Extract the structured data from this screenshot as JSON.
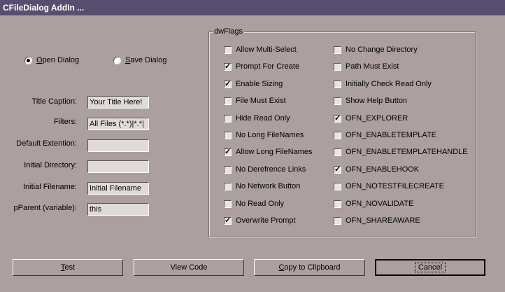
{
  "window": {
    "title": "CFileDialog AddIn ..."
  },
  "dialog_type": {
    "open_label": "Open Dialog",
    "save_label": "Save Dialog",
    "selected": "open"
  },
  "fields": [
    {
      "label": "Title Caption:",
      "value": "Your Title Here!"
    },
    {
      "label": "Filters:",
      "value": "All Files (*.*)|*.*|"
    },
    {
      "label": "Default Extention:",
      "value": ""
    },
    {
      "label": "Initial Directory:",
      "value": ""
    },
    {
      "label": "Initial Filename:",
      "value": "Initial Filename"
    },
    {
      "label": "pParent (variable):",
      "value": "this"
    }
  ],
  "flags": {
    "title": "dwFlags",
    "left": [
      {
        "label": "Allow Multi-Select",
        "checked": false
      },
      {
        "label": "Prompt For Create",
        "checked": true
      },
      {
        "label": "Enable Sizing",
        "checked": true
      },
      {
        "label": "File Must Exist",
        "checked": false
      },
      {
        "label": "Hide Read Only",
        "checked": false
      },
      {
        "label": "No Long FileNames",
        "checked": false
      },
      {
        "label": "Allow Long FileNames",
        "checked": true
      },
      {
        "label": "No Derefrence Links",
        "checked": false
      },
      {
        "label": "No Network Button",
        "checked": false
      },
      {
        "label": "No Read Only",
        "checked": false
      },
      {
        "label": "Overwrite Prompt",
        "checked": true
      }
    ],
    "right": [
      {
        "label": "No Change Directory",
        "checked": false
      },
      {
        "label": "Path Must Exist",
        "checked": false
      },
      {
        "label": "Initially Check Read Only",
        "checked": false
      },
      {
        "label": "Show Help Button",
        "checked": false
      },
      {
        "label": "OFN_EXPLORER",
        "checked": true
      },
      {
        "label": "OFN_ENABLETEMPLATE",
        "checked": false
      },
      {
        "label": "OFN_ENABLETEMPLATEHANDLE",
        "checked": false
      },
      {
        "label": "OFN_ENABLEHOOK",
        "checked": true
      },
      {
        "label": "OFN_NOTESTFILECREATE",
        "checked": false
      },
      {
        "label": "OFN_NOVALIDATE",
        "checked": false
      },
      {
        "label": "OFN_SHAREAWARE",
        "checked": false
      }
    ]
  },
  "buttons": {
    "test": "Test",
    "view_code": "View Code",
    "copy": "Copy to Clipboard",
    "cancel": "Cancel"
  }
}
